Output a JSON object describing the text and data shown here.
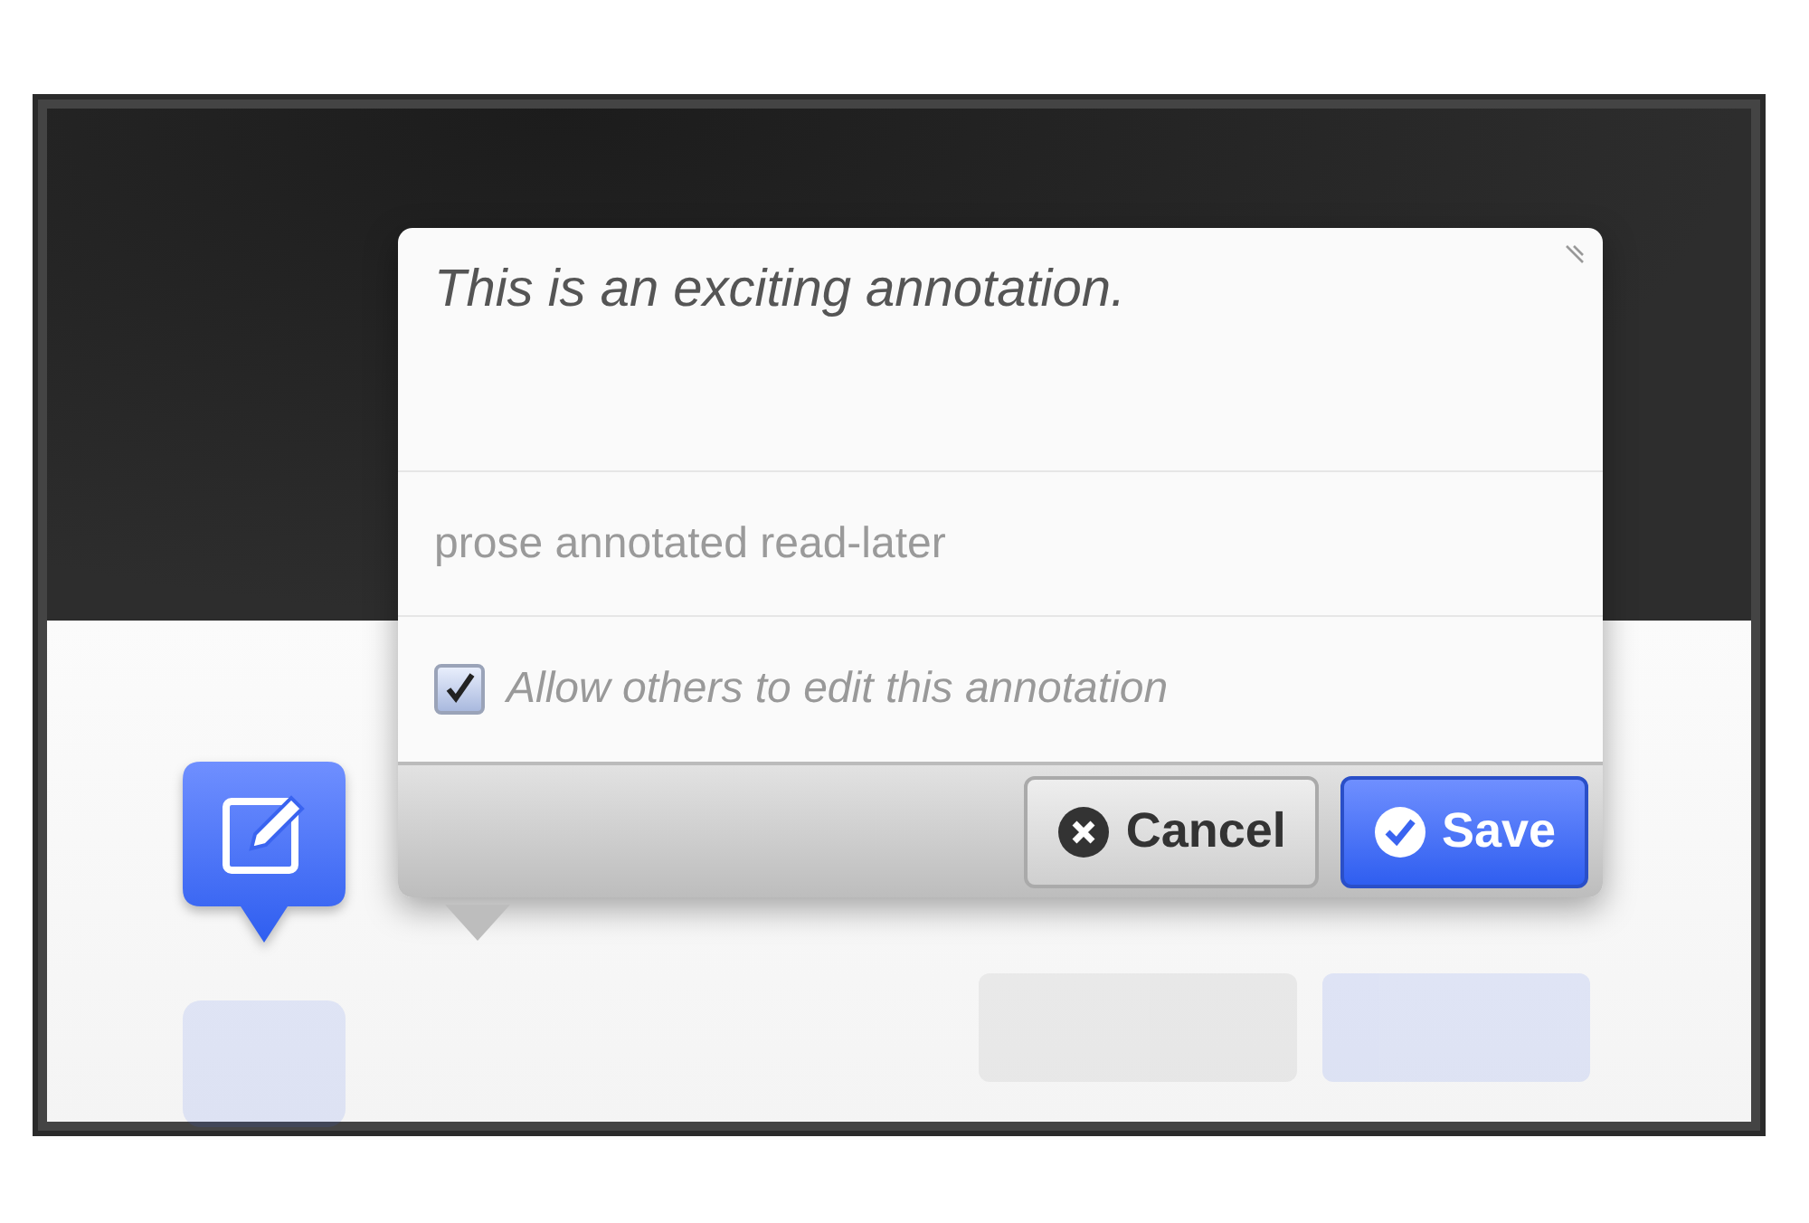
{
  "annotation": {
    "text": "This is an exciting annotation.",
    "tags": "prose annotated read-later",
    "share": {
      "label": "Allow others to edit this annotation",
      "checked": true
    }
  },
  "buttons": [
    {
      "kind": "cancel",
      "label": "Cancel"
    },
    {
      "kind": "save",
      "label": "Save"
    }
  ]
}
